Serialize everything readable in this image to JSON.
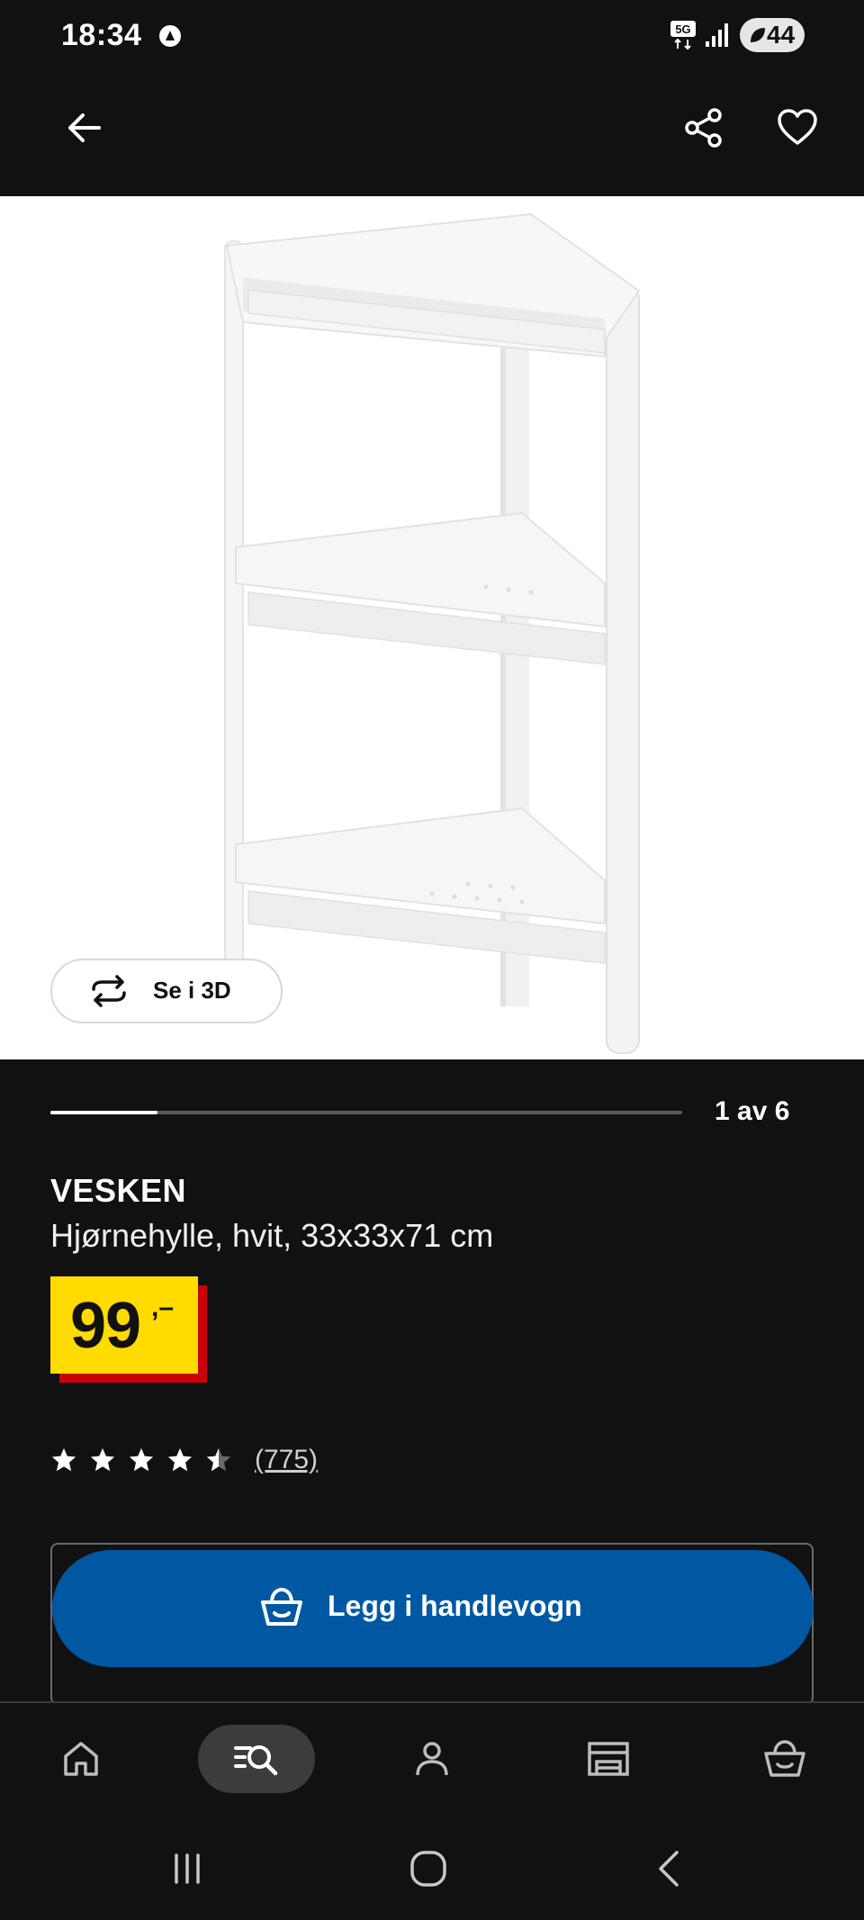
{
  "status_bar": {
    "time": "18:34",
    "network": "5G",
    "battery": "44"
  },
  "top_bar": {
    "back_icon": "arrow-left-icon",
    "share_icon": "share-icon",
    "favorite_icon": "heart-icon"
  },
  "media": {
    "view_3d_label": "Se i 3D",
    "counter": "1 av 6",
    "progress": 0.17
  },
  "product": {
    "name": "VESKEN",
    "description": "Hjørnehylle, hvit, 33x33x71 cm",
    "price": "99",
    "price_suffix": ",–",
    "rating": 4.5,
    "rating_count": "(775)"
  },
  "actions": {
    "add_to_cart_label": "Legg i handlevogn"
  },
  "bottom_nav": {
    "items": [
      {
        "icon": "home-icon"
      },
      {
        "icon": "search-list-icon",
        "active": true
      },
      {
        "icon": "profile-icon"
      },
      {
        "icon": "store-icon"
      },
      {
        "icon": "cart-icon"
      }
    ]
  },
  "colors": {
    "background": "#111111",
    "price_yellow": "#ffdb00",
    "price_red": "#cc0008",
    "button_blue": "#0058a3"
  }
}
